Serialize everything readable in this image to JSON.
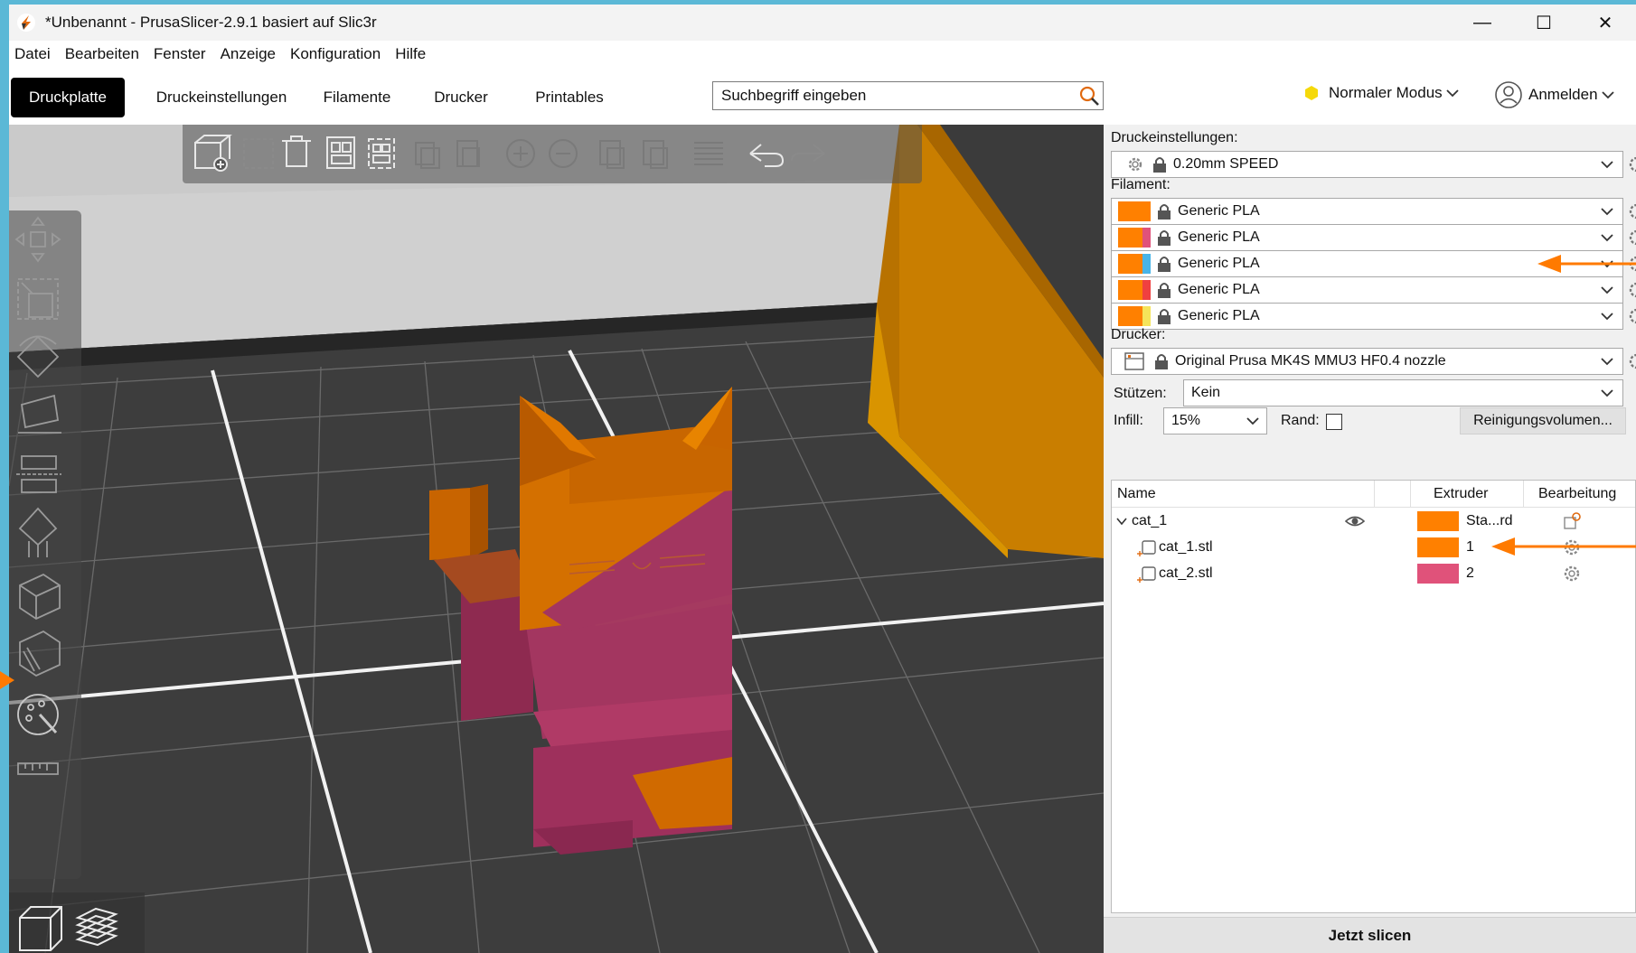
{
  "window": {
    "title": "*Unbenannt - PrusaSlicer-2.9.1 basiert auf Slic3r",
    "minimize": "—",
    "maximize": "☐",
    "close": "✕"
  },
  "menu": [
    "Datei",
    "Bearbeiten",
    "Fenster",
    "Anzeige",
    "Konfiguration",
    "Hilfe"
  ],
  "tabs": [
    "Druckplatte",
    "Druckeinstellungen",
    "Filamente",
    "Drucker",
    "Printables"
  ],
  "search": {
    "placeholder": "Suchbegriff eingeben"
  },
  "mode": {
    "label": "Normaler Modus",
    "color": "#f5d90a"
  },
  "account": {
    "label": "Anmelden"
  },
  "sidebar": {
    "print_settings_label": "Druckeinstellungen:",
    "print_profile": "0.20mm SPEED",
    "filament_label": "Filament:",
    "filaments": [
      {
        "name": "Generic PLA",
        "color_a": "#ff8000",
        "color_b": "#ff8000"
      },
      {
        "name": "Generic PLA",
        "color_a": "#ff8000",
        "color_b": "#e0527a"
      },
      {
        "name": "Generic PLA",
        "color_a": "#ff8000",
        "color_b": "#48b4e8"
      },
      {
        "name": "Generic PLA",
        "color_a": "#ff8000",
        "color_b": "#f04040"
      },
      {
        "name": "Generic PLA",
        "color_a": "#ff8000",
        "color_b": "#f5e45a"
      }
    ],
    "printer_label": "Drucker:",
    "printer_profile": "Original Prusa MK4S MMU3 HF0.4 nozzle",
    "supports_label": "Stützen:",
    "supports_value": "Kein",
    "infill_label": "Infill:",
    "infill_value": "15%",
    "brim_label": "Rand:",
    "purge_button": "Reinigungsvolumen..."
  },
  "object_list": {
    "headers": {
      "name": "Name",
      "extruder": "Extruder",
      "edit": "Bearbeitung"
    },
    "rows": [
      {
        "name": "cat_1",
        "extruder": "Sta...rd",
        "color": "#ff8000"
      },
      {
        "name": "cat_1.stl",
        "extruder": "1",
        "color": "#ff8000"
      },
      {
        "name": "cat_2.stl",
        "extruder": "2",
        "color": "#e0527a"
      }
    ]
  },
  "slice_button": "Jetzt slicen",
  "colors": {
    "accent": "#ff7a00",
    "plate_part_orange": "#d26a00",
    "plate_part_magenta": "#a03a60"
  }
}
